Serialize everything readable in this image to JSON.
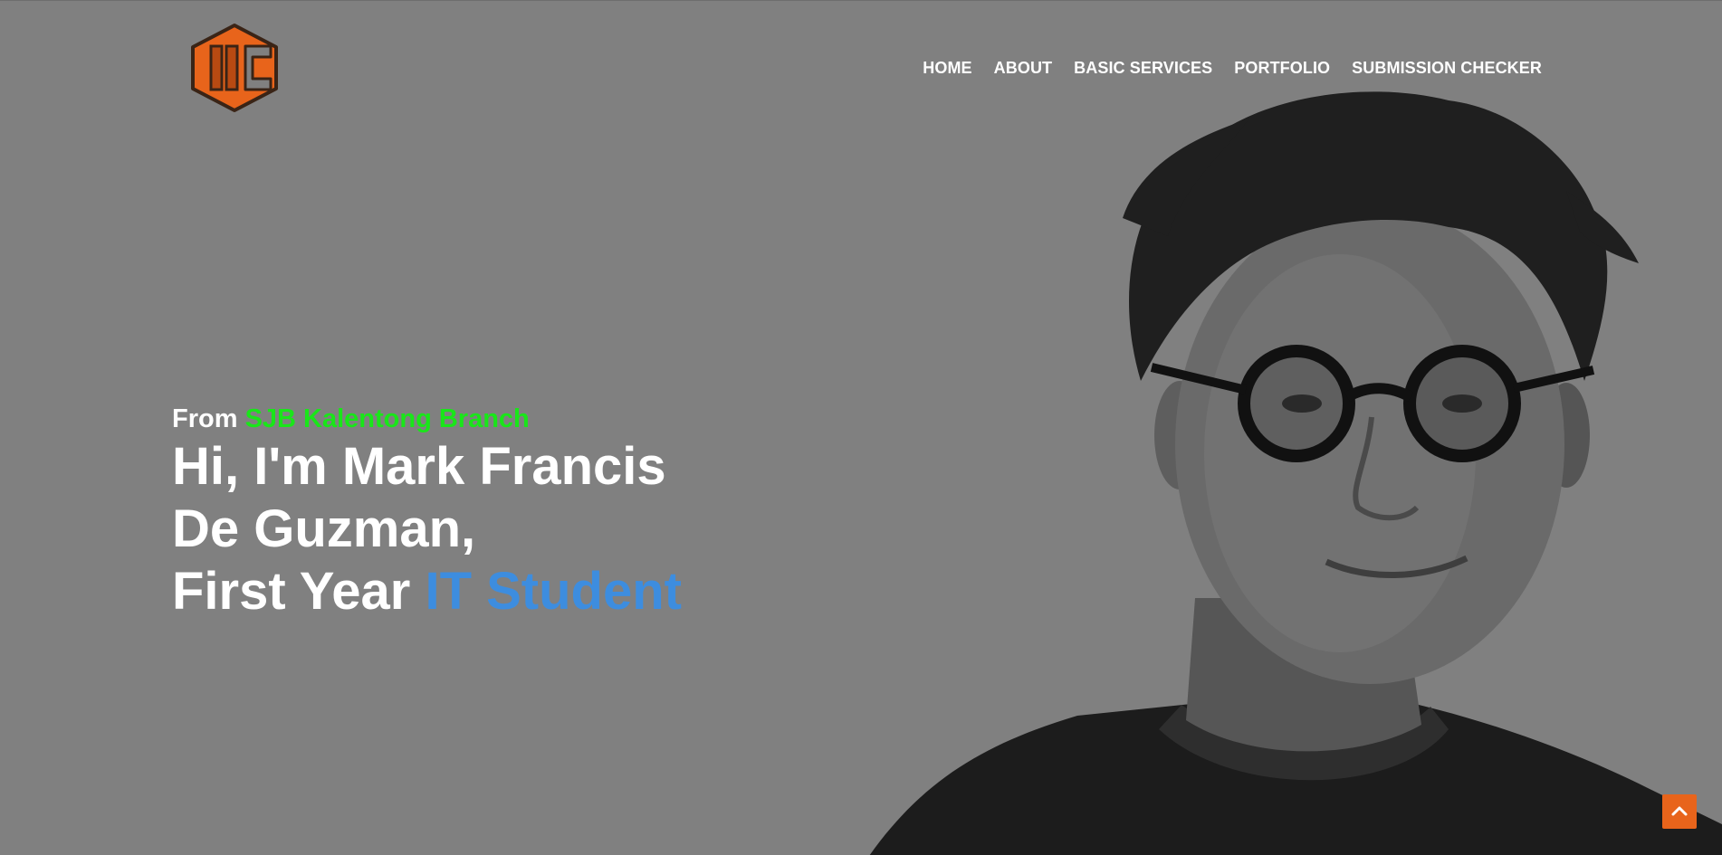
{
  "nav": {
    "items": [
      {
        "label": "HOME"
      },
      {
        "label": "ABOUT"
      },
      {
        "label": "BASIC SERVICES"
      },
      {
        "label": "PORTFOLIO"
      },
      {
        "label": "SUBMISSION CHECKER"
      }
    ]
  },
  "hero": {
    "from_prefix": "From",
    "branch": "SJB Kalentong Branch",
    "line1": "Hi, I'm Mark Francis",
    "line2": "De Guzman,",
    "line3_prefix": "First Year",
    "line3_accent": "IT Student"
  },
  "colors": {
    "background": "#808080",
    "logo_orange": "#e8641b",
    "branch_green": "#19e619",
    "accent_blue": "#3d8ddf",
    "scroll_button": "#e8641b"
  },
  "icons": {
    "logo": "hexagon-logo-icon",
    "scroll_top": "chevron-up-icon"
  }
}
